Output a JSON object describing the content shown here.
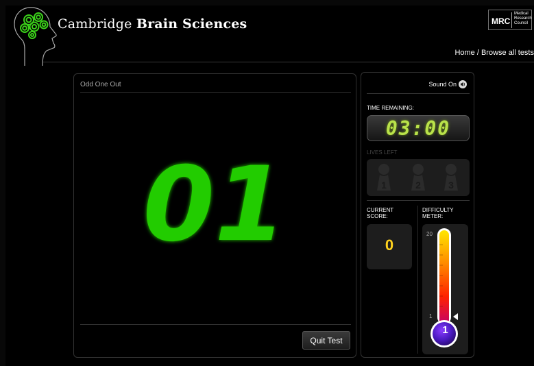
{
  "header": {
    "brand_regular": "Cambridge",
    "brand_bold": "Brain Sciences",
    "mrc_logo": {
      "main": "MRC",
      "sub_lines": [
        "Medical",
        "Research",
        "Council"
      ]
    },
    "nav": "Home / Browse all tests"
  },
  "test": {
    "title": "Odd One Out",
    "countdown": "01",
    "quit_label": "Quit Test"
  },
  "side": {
    "sound_label": "Sound On",
    "time_label": "TIME REMAINING:",
    "time_value": "03:00",
    "lives_label": "LIVES LEFT",
    "lives": [
      1,
      2,
      3
    ],
    "score_label_1": "CURRENT",
    "score_label_2": "SCORE:",
    "score_value": "0",
    "meter_label_1": "DIFFICULTY",
    "meter_label_2": "METER:",
    "meter_max": "20",
    "meter_min": "1",
    "meter_level": "1"
  },
  "colors": {
    "countdown_green": "#22cc00",
    "timer_green": "#b9e24a",
    "score_yellow": "#ffd21e",
    "brain_green": "#2fc21a"
  },
  "icons": [
    "brain-head-logo",
    "speaker-icon",
    "pawn-icon"
  ]
}
